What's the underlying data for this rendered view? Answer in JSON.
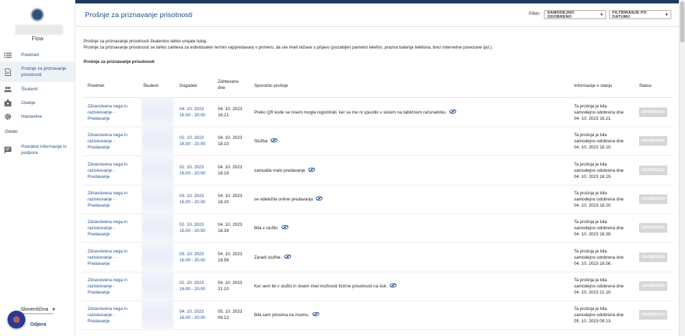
{
  "sidebar": {
    "app_name": "Flow",
    "items": [
      {
        "label": "Predmeti",
        "icon": "list-icon"
      },
      {
        "label": "Prošnje za priznavanje prisotnosti",
        "icon": "document-icon"
      },
      {
        "label": "Študenti",
        "icon": "people-icon"
      },
      {
        "label": "Osebje",
        "icon": "badge-icon"
      },
      {
        "label": "Nastavitve",
        "icon": "gear-icon"
      }
    ],
    "section_other": "Ostalo",
    "feedback": {
      "label": "Povratne informacije in podpora",
      "icon": "chat-icon"
    },
    "language": "Slovenščina",
    "logout": "Odjava"
  },
  "header": {
    "title": "Prošnje za priznavanje prisotnosti",
    "filter_label": "Filter:",
    "filter_status": "SAMODEJNO ODOBRENO",
    "filter_date": "FILTRIRANJE PO DATUMU"
  },
  "intro": {
    "line1": "Prošnje za priznavanje prisotnosti študentov lahko urejate tukaj.",
    "line2": "Prošnje za priznavanje prisotnosti se lahko zahteva za individualen termin vaj/predavanj v primeru, da ste imeli težave s prijavo (pozabljen pametni telefon, prazna baterija telefona, brez internetne povezave ipd.).",
    "subheading": "Prošnje za priznavanje prisotnosti"
  },
  "table": {
    "headers": {
      "subject": "Predmet",
      "student": "Študent",
      "event": "Dogodek",
      "requested": "Zahtevano dne",
      "message": "Sporočilo prošnje",
      "info": "Informacije o stanju",
      "status": "Status"
    },
    "rows": [
      {
        "subject": "Zdravstvena nega in raziskovanje - Predavanje",
        "event_date": "04. 10. 2023",
        "event_time": "16.00 - 20.00",
        "req_date": "04. 10. 2023",
        "req_time": "16.21",
        "message": "Preko QR kode se nisem mogla registrirati, ker se me ni spustilo v sistem na tabličnem računalniku.",
        "info": "Ta prošnja je bila samodejno odobrena dne 04. 10. 2023 16.21.",
        "status": "ODOBRENO"
      },
      {
        "subject": "Zdravstvena nega in raziskovanje - Predavanje",
        "event_date": "02. 10. 2023",
        "event_time": "16.00 - 20.00",
        "req_date": "04. 10. 2023",
        "req_time": "18.10",
        "message": "Služba",
        "info": "Ta prošnja je bila samodejno odobrena dne 04. 10. 2023 18.10.",
        "status": "ODOBRENO"
      },
      {
        "subject": "Zdravstvena nega in raziskovanje - Predavanje",
        "event_date": "02. 10. 2023",
        "event_time": "16.00 - 20.00",
        "req_date": "04. 10. 2023",
        "req_time": "18.19",
        "message": "zamudila malo predavanje",
        "info": "Ta prošnja je bila samodejno odobrena dne 04. 10. 2023 18.19.",
        "status": "ODOBRENO"
      },
      {
        "subject": "Zdravstvena nega in raziskovanje - Predavanje",
        "event_date": "03. 10. 2023",
        "event_time": "16.00 - 20.00",
        "req_date": "04. 10. 2023",
        "req_time": "18.20",
        "message": "se odeležila online predavanja",
        "info": "Ta prošnja je bila samodejno odobrena dne 04. 10. 2023 18.20.",
        "status": "ODOBRENO"
      },
      {
        "subject": "Zdravstvena nega in raziskovanje - Predavanje",
        "event_date": "02. 10. 2023",
        "event_time": "16.00 - 20.00",
        "req_date": "04. 10. 2023",
        "req_time": "18.39",
        "message": "Bila v službi.",
        "info": "Ta prošnja je bila samodejno odobrena dne 04. 10. 2023 18.39.",
        "status": "ODOBRENO"
      },
      {
        "subject": "Zdravstvena nega in raziskovanje - Predavanje",
        "event_date": "03. 10. 2023",
        "event_time": "16.00 - 20.00",
        "req_date": "04. 10. 2023",
        "req_time": "18.56",
        "message": "Zaradi službe.",
        "info": "Ta prošnja je bila samodejno odobrena dne 04. 10. 2023 18.56.",
        "status": "ODOBRENO"
      },
      {
        "subject": "Zdravstvena nega in raziskovanje - Predavanje",
        "event_date": "02. 10. 2023",
        "event_time": "16.00 - 20.00",
        "req_date": "04. 10. 2023",
        "req_time": "21.10",
        "message": "Ker sem bil v službi in nisem imel možnosti fizične prisotnosti na šoli.",
        "info": "Ta prošnja je bila samodejno odobrena dne 04. 10. 2023 21.10.",
        "status": "ODOBRENO"
      },
      {
        "subject": "Zdravstvena nega in raziskovanje - Predavanje",
        "event_date": "04. 10. 2023",
        "event_time": "16.00 - 20.00",
        "req_date": "05. 10. 2023",
        "req_time": "09.13",
        "message": "Bila sem priostna na zoomu.",
        "info": "Ta prošnja je bila samodejno odobrena dne 05. 10. 2023 09.13.",
        "status": "ODOBRENO"
      }
    ]
  }
}
